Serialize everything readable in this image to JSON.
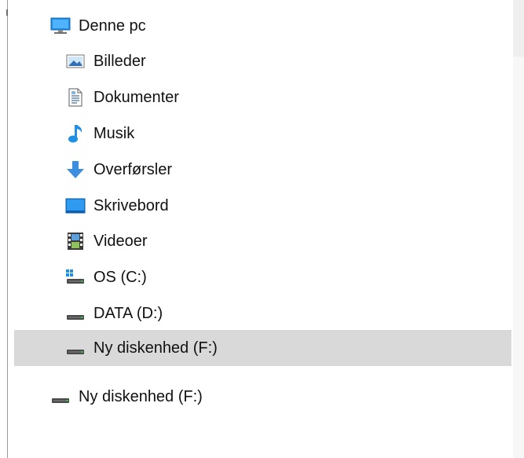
{
  "tree": {
    "root": {
      "label": "Denne pc",
      "icon": "computer-icon"
    },
    "children": [
      {
        "label": "Billeder",
        "icon": "pictures-icon"
      },
      {
        "label": "Dokumenter",
        "icon": "documents-icon"
      },
      {
        "label": "Musik",
        "icon": "music-icon"
      },
      {
        "label": "Overførsler",
        "icon": "downloads-icon"
      },
      {
        "label": "Skrivebord",
        "icon": "desktop-icon"
      },
      {
        "label": "Videoer",
        "icon": "videos-icon"
      },
      {
        "label": "OS (C:)",
        "icon": "os-drive-icon"
      },
      {
        "label": "DATA (D:)",
        "icon": "drive-icon"
      },
      {
        "label": "Ny diskenhed (F:)",
        "icon": "drive-icon",
        "selected": true
      }
    ],
    "removable": {
      "label": "Ny diskenhed (F:)",
      "icon": "drive-icon"
    }
  },
  "colors": {
    "selection": "#d9d9d9",
    "accent": "#1e90e6",
    "drive_led": "#3cb14a"
  }
}
